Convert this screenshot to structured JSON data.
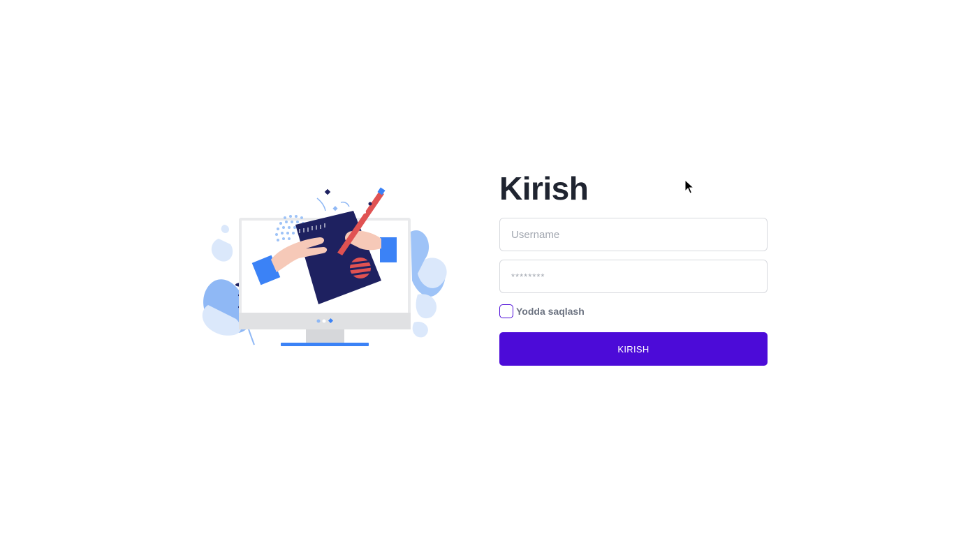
{
  "login": {
    "title": "Kirish",
    "username_placeholder": "Username",
    "password_placeholder": "********",
    "remember_label": "Yodda saqlash",
    "submit_label": "KIRISH"
  },
  "colors": {
    "accent": "#4c0bd8",
    "title": "#1f2430",
    "illustration_navy": "#1e2160",
    "illustration_blue": "#3b82f6",
    "illustration_light_blue": "#9ec3f7",
    "illustration_red": "#e05252",
    "illustration_skin": "#f6c9b8"
  },
  "icons": {
    "cursor": "mouse-pointer-icon",
    "illustration": "computer-signing-document-illustration"
  }
}
